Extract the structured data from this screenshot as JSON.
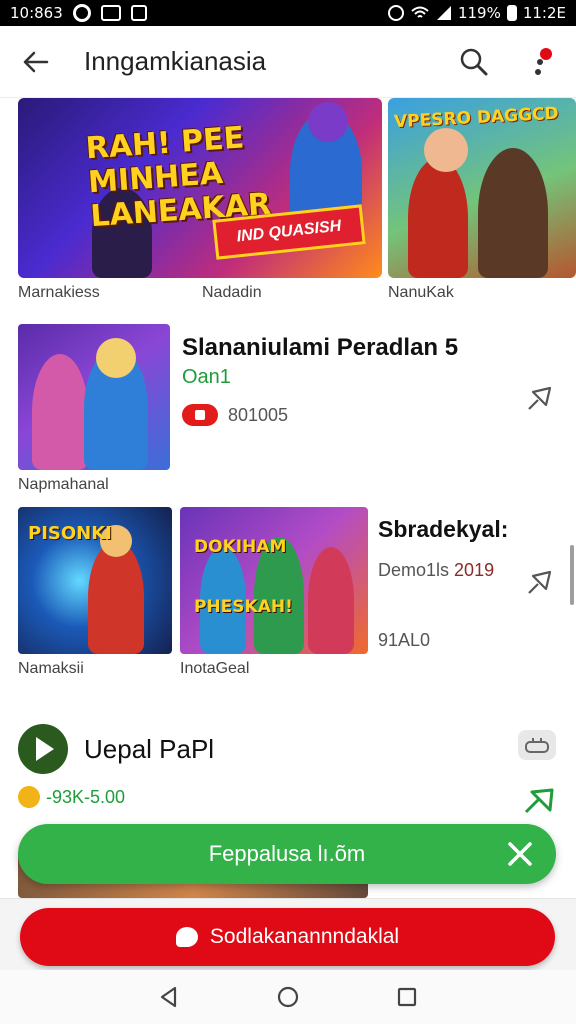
{
  "statusbar": {
    "time_left": "10:863",
    "battery": "119%",
    "time_right": "11:2E"
  },
  "appbar": {
    "title": "Inngamkianasia"
  },
  "banners": [
    {
      "title": "RAH! PEE MINHEA LANEAKAR",
      "ribbon": "IND QUASISH",
      "caption": "Marnakiess"
    },
    {
      "title": "VPESRO DAGGCD",
      "caption": "NanuKak"
    }
  ],
  "banner_middle_caption": "Nadadin",
  "list1": {
    "thumb_caption": "Napmahanal",
    "title": "Slananiulami Peradlan 5",
    "subtitle": "Oan1",
    "count": "801005"
  },
  "list2": {
    "thumbs": [
      {
        "label": "PISONKI",
        "caption": "Namaksii"
      },
      {
        "label": "DOKIHAM PHESKAH!",
        "caption": "InotaGeal"
      }
    ],
    "title": "Sbradekyal:",
    "subtitle_prefix": "Demo1ls",
    "subtitle_year": "2019",
    "count": "91AL0"
  },
  "app": {
    "name": "Uepal PaPl",
    "rating": "-93K-5.00"
  },
  "green_bar": {
    "label": "Feppalusa lı.õm"
  },
  "red_button": {
    "label": "Sodlakanannndaklal"
  },
  "colors": {
    "accent_red": "#e00a16",
    "accent_green": "#33b24a",
    "text_green": "#1f9d3a"
  },
  "icons": [
    "back-arrow-icon",
    "search-icon",
    "more-icon",
    "pin-icon",
    "close-icon",
    "chat-bubble-icon",
    "nav-back-icon",
    "nav-home-icon",
    "nav-recents-icon"
  ]
}
